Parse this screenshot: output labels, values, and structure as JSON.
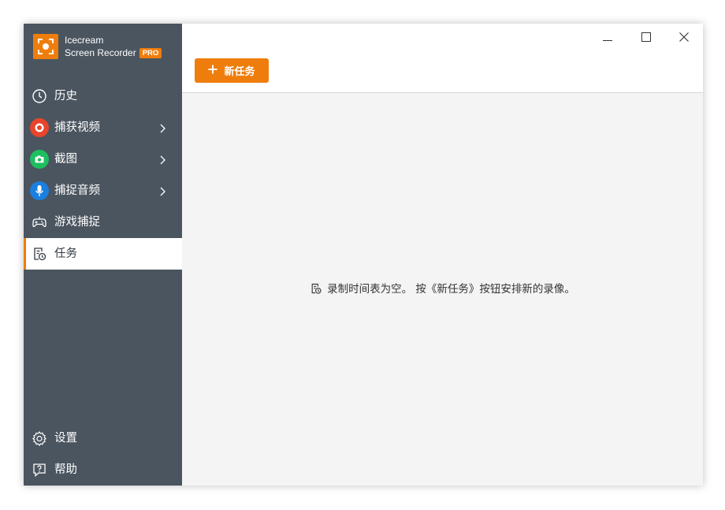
{
  "app": {
    "brand_line1": "Icecream",
    "brand_line2": "Screen Recorder",
    "badge": "PRO",
    "accent_color": "#ef7d0c",
    "sidebar_color": "#4b5560"
  },
  "sidebar": {
    "items": [
      {
        "label": "历史",
        "icon": "clock-icon"
      },
      {
        "label": "捕获视频",
        "icon": "record-icon",
        "color": "#e8452c",
        "has_submenu": true
      },
      {
        "label": "截图",
        "icon": "camera-icon",
        "color": "#1dbf5e",
        "has_submenu": true
      },
      {
        "label": "捕捉音频",
        "icon": "microphone-icon",
        "color": "#1a7fe0",
        "has_submenu": true
      },
      {
        "label": "游戏捕捉",
        "icon": "gamepad-icon"
      },
      {
        "label": "任务",
        "icon": "task-schedule-icon",
        "active": true
      }
    ],
    "bottom_items": [
      {
        "label": "设置",
        "icon": "gear-icon"
      },
      {
        "label": "帮助",
        "icon": "help-icon"
      }
    ]
  },
  "window_controls": [
    "minimize-icon",
    "maximize-icon",
    "close-icon"
  ],
  "toolbar": {
    "new_task_label": "新任务",
    "new_task_icon": "plus-icon"
  },
  "main": {
    "empty_message": "录制时间表为空。 按《新任务》按钮安排新的录像。",
    "empty_icon": "task-schedule-icon"
  }
}
